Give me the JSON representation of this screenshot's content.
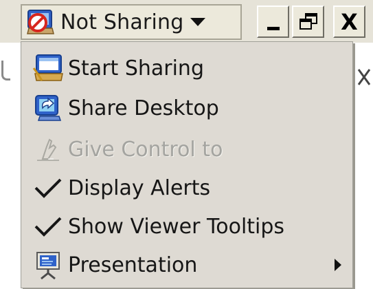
{
  "titlebar": {
    "sharing_label": "Not Sharing",
    "sharing_icon": "not-sharing-icon",
    "minimize_icon": "minimize-icon",
    "restore_icon": "restore-icon",
    "close_glyph": "X"
  },
  "menu": {
    "items": [
      {
        "label": "Start Sharing",
        "icon": "start-sharing-icon",
        "enabled": true
      },
      {
        "label": "Share Desktop",
        "icon": "share-desktop-icon",
        "enabled": true
      },
      {
        "label": "Give Control to",
        "icon": "give-control-icon",
        "enabled": false
      },
      {
        "label": "Display Alerts",
        "icon": "checkmark-icon",
        "enabled": true,
        "checked": true
      },
      {
        "label": "Show Viewer Tooltips",
        "icon": "checkmark-icon",
        "enabled": true,
        "checked": true
      },
      {
        "label": "Presentation",
        "icon": "presentation-icon",
        "enabled": true,
        "submenu": true
      }
    ]
  },
  "colors": {
    "menu_background": "#dedad3",
    "disabled_text": "#a4a4a0",
    "title_strip": "#e6e3d8"
  }
}
